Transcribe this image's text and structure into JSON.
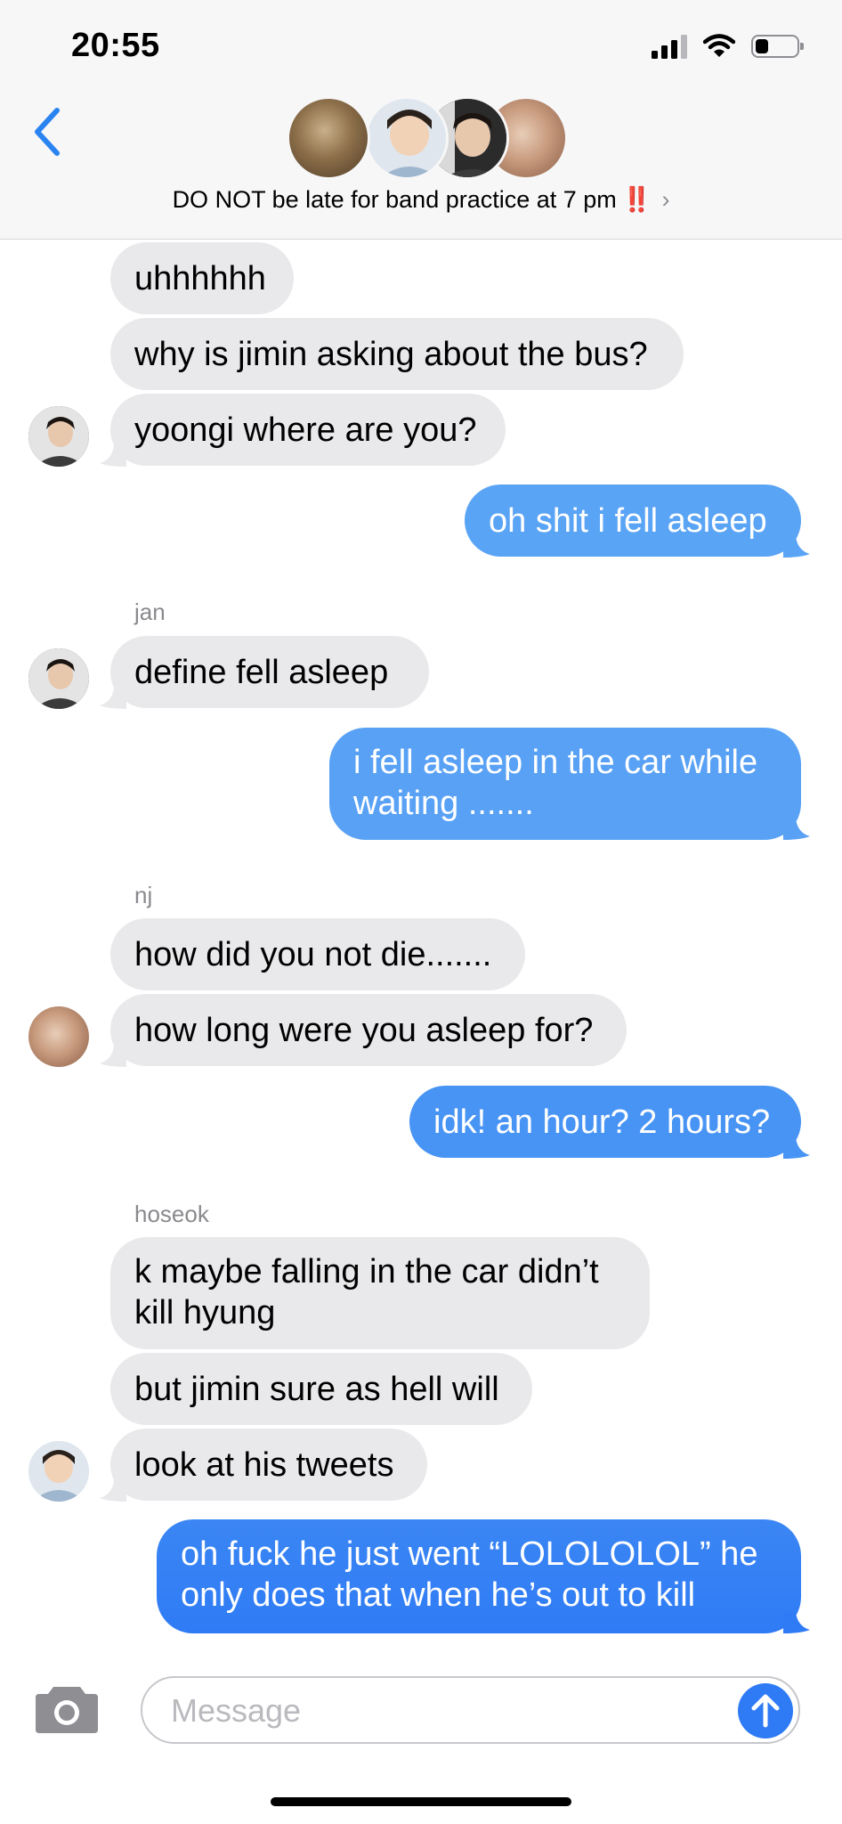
{
  "status_bar": {
    "time": "20:55",
    "icons": [
      "signal-icon",
      "wifi-icon",
      "battery-icon"
    ],
    "signal_bars": 4,
    "signal_bars_active": 3,
    "battery_level": 0.3
  },
  "header": {
    "group_name": "DO NOT be late for band practice at 7 pm",
    "emoji": "‼️",
    "chevron": "›",
    "avatar_count": 4
  },
  "messages": [
    {
      "id": 1,
      "dir": "in",
      "text": "uhhhhhh"
    },
    {
      "id": 2,
      "dir": "in",
      "text": "why is jimin asking about the bus?"
    },
    {
      "id": 3,
      "dir": "in",
      "text": "yoongi where are you?"
    },
    {
      "id": 4,
      "dir": "out",
      "text": "oh shit i fell asleep"
    },
    {
      "id": 5,
      "dir": "in",
      "sender": "jan",
      "text": "define fell asleep"
    },
    {
      "id": 6,
      "dir": "out",
      "text": "i fell asleep in the car while waiting ......."
    },
    {
      "id": 7,
      "dir": "in",
      "sender": "nj",
      "text": "how did you not die......."
    },
    {
      "id": 8,
      "dir": "in",
      "text": "how long were you asleep for?"
    },
    {
      "id": 9,
      "dir": "out",
      "text": "idk! an hour? 2 hours?"
    },
    {
      "id": 10,
      "dir": "in",
      "sender": "hoseok",
      "text": "k maybe falling in the car didn’t kill hyung"
    },
    {
      "id": 11,
      "dir": "in",
      "text": "but jimin sure as hell will"
    },
    {
      "id": 12,
      "dir": "in",
      "text": "look at his tweets"
    },
    {
      "id": 13,
      "dir": "out",
      "text": "oh fuck he just went “LOLOLOLOL” he only does that when he’s out to kill"
    }
  ],
  "composer": {
    "placeholder": "Message"
  },
  "colors": {
    "incoming_bubble": "#e9e9eb",
    "outgoing_light": "#5aa4f5",
    "outgoing_dark": "#2f7bf5",
    "accent": "#2a84f0",
    "alert": "#e0262b"
  }
}
